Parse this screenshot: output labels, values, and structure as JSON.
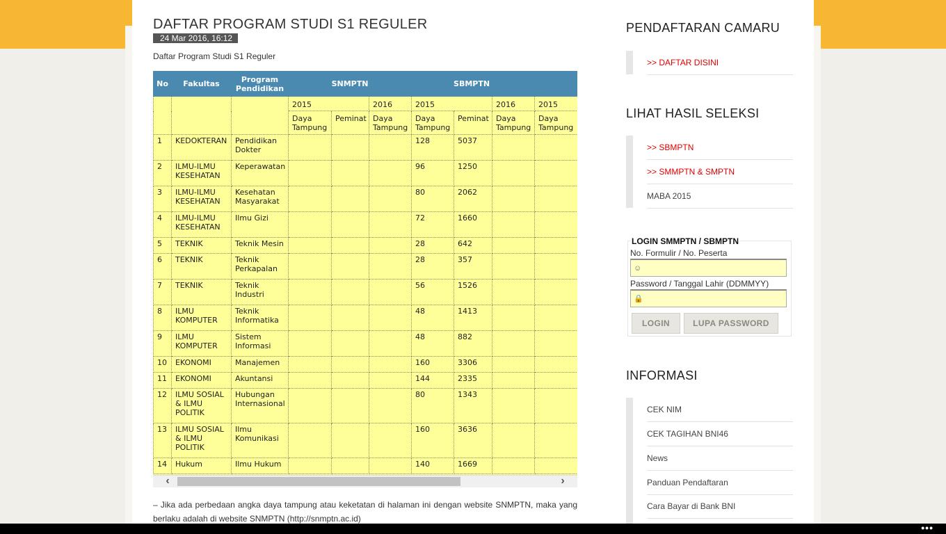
{
  "article": {
    "title": "DAFTAR PROGRAM STUDI S1 REGULER",
    "date": "24 Mar 2016, 16:12",
    "intro": "Daftar Program Studi S1 Reguler",
    "note": "– Jika ada perbedaan angka daya tampung atau keketatan di halaman ini dengan website SNMPTN, maka yang berlaku adalah di website SNMPTN (http://snmptn.ac.id)"
  },
  "table": {
    "headers": {
      "no": "No",
      "fakultas": "Fakultas",
      "program": "Program Pendidikan",
      "snmptn": "SNMPTN",
      "sbmptn": "SBMPTN"
    },
    "years": [
      "2015",
      "2016",
      "2015",
      "2016",
      "2015"
    ],
    "subheaders": [
      "Daya Tampung",
      "Peminat",
      "Daya Tampung",
      "Daya Tampung",
      "Peminat",
      "Daya Tampung",
      "Daya Tampung"
    ],
    "rows": [
      {
        "no": "1",
        "fakultas": "KEDOKTERAN",
        "program": "Pendidikan Dokter",
        "dt": "128",
        "peminat": "5037"
      },
      {
        "no": "2",
        "fakultas": "ILMU-ILMU KESEHATAN",
        "program": "Keperawatan",
        "dt": "96",
        "peminat": "1250"
      },
      {
        "no": "3",
        "fakultas": "ILMU-ILMU KESEHATAN",
        "program": "Kesehatan Masyarakat",
        "dt": "80",
        "peminat": "2062"
      },
      {
        "no": "4",
        "fakultas": "ILMU-ILMU KESEHATAN",
        "program": "Ilmu Gizi",
        "dt": "72",
        "peminat": "1660"
      },
      {
        "no": "5",
        "fakultas": "TEKNIK",
        "program": "Teknik Mesin",
        "dt": "28",
        "peminat": "642"
      },
      {
        "no": "6",
        "fakultas": "TEKNIK",
        "program": "Teknik Perkapalan",
        "dt": "28",
        "peminat": "357"
      },
      {
        "no": "7",
        "fakultas": "TEKNIK",
        "program": "Teknik Industri",
        "dt": "56",
        "peminat": "1526"
      },
      {
        "no": "8",
        "fakultas": "ILMU KOMPUTER",
        "program": "Teknik Informatika",
        "dt": "48",
        "peminat": "1413"
      },
      {
        "no": "9",
        "fakultas": "ILMU KOMPUTER",
        "program": "Sistem Informasi",
        "dt": "48",
        "peminat": "882"
      },
      {
        "no": "10",
        "fakultas": "EKONOMI",
        "program": "Manajemen",
        "dt": "160",
        "peminat": "3306"
      },
      {
        "no": "11",
        "fakultas": "EKONOMI",
        "program": "Akuntansi",
        "dt": "144",
        "peminat": "2335"
      },
      {
        "no": "12",
        "fakultas": "ILMU SOSIAL & ILMU POLITIK",
        "program": "Hubungan Internasional",
        "dt": "80",
        "peminat": "1343"
      },
      {
        "no": "13",
        "fakultas": "ILMU SOSIAL & ILMU POLITIK",
        "program": "Ilmu Komunikasi",
        "dt": "160",
        "peminat": "3636"
      },
      {
        "no": "14",
        "fakultas": "Hukum",
        "program": "Ilmu Hukum",
        "dt": "140",
        "peminat": "1669"
      }
    ]
  },
  "sidebar": {
    "pendaftaran": {
      "heading": "PENDAFTARAN CAMARU",
      "links": [
        ">> DAFTAR DISINI"
      ]
    },
    "hasil": {
      "heading": "LIHAT HASIL SELEKSI",
      "links": [
        ">> SBMPTN",
        ">> SMMPTN & SMPTN",
        "MABA 2015"
      ]
    },
    "login": {
      "legend": "LOGIN SMMPTN / SBMPTN",
      "user_label": "No. Formulir / No. Peserta",
      "pass_label": "Password / Tanggal Lahir (DDMMYY)",
      "login_button": "LOGIN",
      "forgot_button": "LUPA PASSWORD"
    },
    "informasi": {
      "heading": "INFORMASI",
      "links": [
        "CEK NIM",
        "CEK TAGIHAN BNI46",
        "News",
        "Panduan Pendaftaran",
        "Cara Bayar di Bank BNI"
      ]
    }
  },
  "taskbar": {
    "dots": "•••"
  },
  "colors": {
    "top_band": "#f8b733",
    "table_header": "#4a8ab0",
    "table_body": "#ffff99",
    "link_red": "#e00000"
  }
}
